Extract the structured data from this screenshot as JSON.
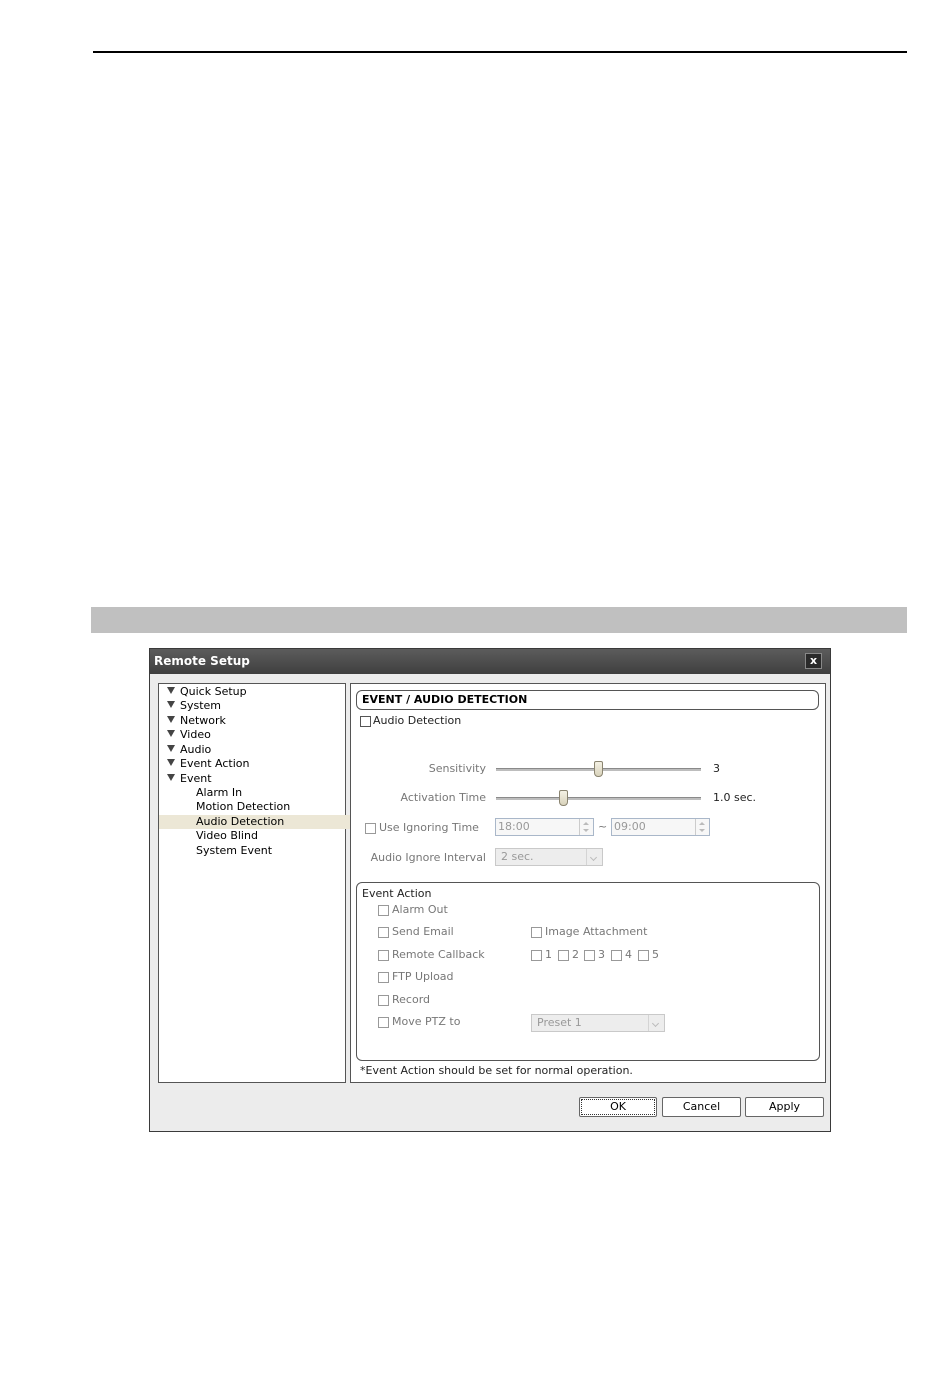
{
  "dialog": {
    "title": "Remote Setup",
    "close_label": "x"
  },
  "tree": {
    "groups": [
      "Quick Setup",
      "System",
      "Network",
      "Video",
      "Audio",
      "Event Action",
      "Event"
    ],
    "event_children": [
      "Alarm In",
      "Motion Detection",
      "Audio Detection",
      "Video Blind",
      "System Event"
    ],
    "selected": "Audio Detection"
  },
  "panel": {
    "header": "EVENT / AUDIO DETECTION",
    "audio_detection_label": "Audio Detection",
    "audio_detection_checked": false,
    "sensitivity": {
      "label": "Sensitivity",
      "value": "3",
      "level": 0.5
    },
    "activation_time": {
      "label": "Activation Time",
      "value": "1.0 sec.",
      "level": 0.33
    },
    "ignoring_time": {
      "label": "Use Ignoring Time",
      "from": "18:00",
      "separator": "~",
      "to": "09:00"
    },
    "ignore_interval": {
      "label": "Audio Ignore Interval",
      "value": "2 sec."
    },
    "event_action": {
      "title": "Event Action",
      "alarm_out": "Alarm Out",
      "send_email": "Send Email",
      "image_attachment": "Image Attachment",
      "remote_callback": "Remote Callback",
      "callback_numbers": [
        "1",
        "2",
        "3",
        "4",
        "5"
      ],
      "ftp_upload": "FTP Upload",
      "record": "Record",
      "move_ptz": "Move PTZ to",
      "preset": "Preset  1"
    },
    "note": "*Event Action should be set for normal operation."
  },
  "buttons": {
    "ok": "OK",
    "cancel": "Cancel",
    "apply": "Apply"
  }
}
